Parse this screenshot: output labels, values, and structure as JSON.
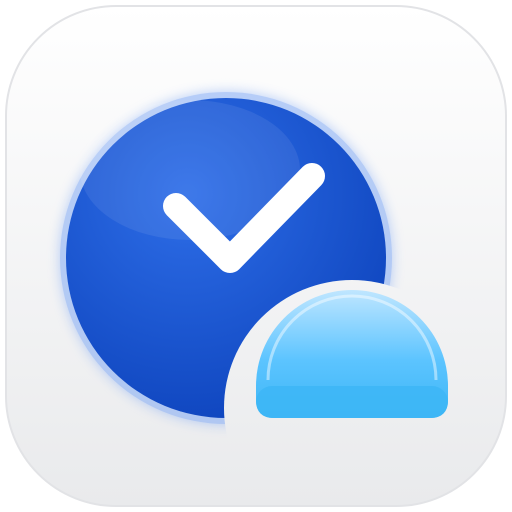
{
  "app_icon": {
    "semantic": "task-check-person-icon",
    "colors": {
      "tile_top": "#ffffff",
      "tile_bottom": "#e9eaec",
      "tile_border": "#e2e3e6",
      "disc_light": "#2e6ee8",
      "disc_dark": "#0a3fb8",
      "disc_rim": "#7fa8f5",
      "check": "#ffffff",
      "dome_top": "#bfe6ff",
      "dome_mid": "#5cc4ff",
      "dome_band": "#3db6f6"
    }
  }
}
